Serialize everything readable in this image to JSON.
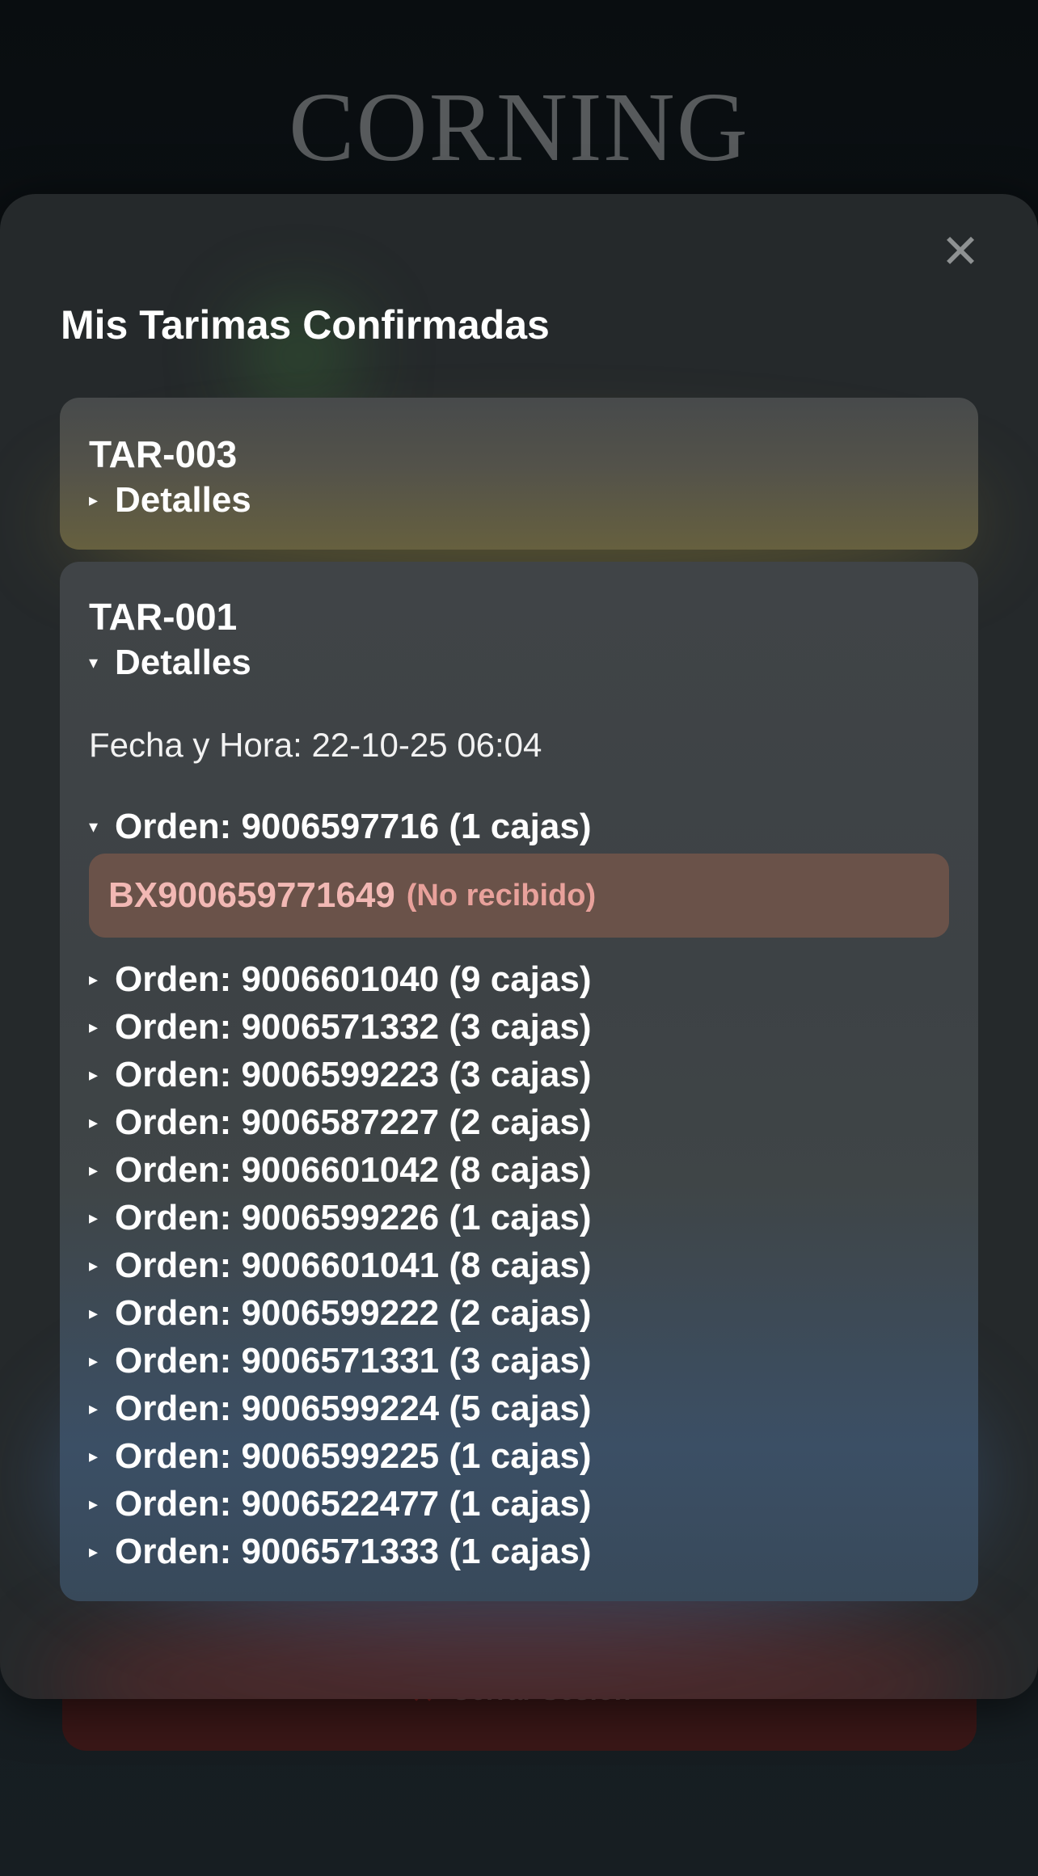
{
  "background": {
    "logo_text": "CORNING",
    "logout_label": "Cerrar Sesión",
    "logout_icon": "close-x-icon"
  },
  "modal": {
    "title": "Mis Tarimas Confirmadas",
    "close_icon": "close-icon",
    "close_glyph": "✕",
    "cards": [
      {
        "id": "TAR-003",
        "details_label": "Detalles",
        "expanded": false
      },
      {
        "id": "TAR-001",
        "details_label": "Detalles",
        "expanded": true,
        "fecha": "Fecha y Hora: 22-10-25 06:04",
        "orders": [
          {
            "label": "Orden: 9006597716 (1 cajas)",
            "expanded": true,
            "boxes": [
              {
                "code": "BX900659771649",
                "status": "(No recibido)"
              }
            ]
          },
          {
            "label": "Orden: 9006601040 (9 cajas)",
            "expanded": false
          },
          {
            "label": "Orden: 9006571332 (3 cajas)",
            "expanded": false
          },
          {
            "label": "Orden: 9006599223 (3 cajas)",
            "expanded": false
          },
          {
            "label": "Orden: 9006587227 (2 cajas)",
            "expanded": false
          },
          {
            "label": "Orden: 9006601042 (8 cajas)",
            "expanded": false
          },
          {
            "label": "Orden: 9006599226 (1 cajas)",
            "expanded": false
          },
          {
            "label": "Orden: 9006601041 (8 cajas)",
            "expanded": false
          },
          {
            "label": "Orden: 9006599222 (2 cajas)",
            "expanded": false
          },
          {
            "label": "Orden: 9006571331 (3 cajas)",
            "expanded": false
          },
          {
            "label": "Orden: 9006599224 (5 cajas)",
            "expanded": false
          },
          {
            "label": "Orden: 9006599225 (1 cajas)",
            "expanded": false
          },
          {
            "label": "Orden: 9006522477 (1 cajas)",
            "expanded": false
          },
          {
            "label": "Orden: 9006571333 (1 cajas)",
            "expanded": false
          }
        ]
      }
    ]
  },
  "colors": {
    "modal_bg": "#25292b",
    "box_bg": "#6a5249",
    "box_text": "#f2b8b4",
    "logout_bg": "#3a1717"
  }
}
